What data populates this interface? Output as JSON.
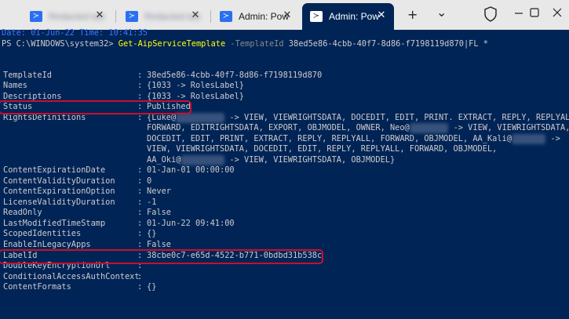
{
  "tabs": [
    {
      "title": "Redacted tab",
      "icon": "powershell-icon",
      "blurred": true,
      "active": false
    },
    {
      "title": "Redacted tab",
      "icon": "powershell-icon",
      "blurred": true,
      "active": false
    },
    {
      "title": "Admin: Pow",
      "icon": "powershell-icon",
      "blurred": false,
      "active": false
    },
    {
      "title": "Admin: Pow",
      "icon": "powershell-icon",
      "blurred": false,
      "active": true
    }
  ],
  "close_glyph": "✕",
  "new_tab_glyph": "+",
  "dropdown_glyph": "⌄",
  "icon_glyph": "≻",
  "terminal": {
    "date_line": "Date: 01-Jun-22 Time: 10:41:35",
    "prompt": "PS C:\\WINDOWS\\system32> ",
    "cmdlet": "Get-AipServiceTemplate",
    "param": "-TemplateId",
    "argument": "38ed5e86-4cbb-40f7-8d86-f7198119d870|FL *",
    "separator": ":",
    "props": {
      "templateid": {
        "key": "TemplateId",
        "value": "38ed5e86-4cbb-40f7-8d86-f7198119d870"
      },
      "names": {
        "key": "Names",
        "value": "{1033 -> RolesLabel}"
      },
      "descriptions": {
        "key": "Descriptions",
        "value": "{1033 -> RolesLabel}"
      },
      "status": {
        "key": "Status",
        "value": "Published"
      },
      "rights": {
        "key": "RightsDefinitions",
        "l1a": "{Luke@",
        "l1b": " -> VIEW, VIEWRIGHTSDATA, DOCEDIT, EDIT, PRINT. EXTRACT, REPLY, REPLYALL,",
        "l2a": "FORWARD, EDITRIGHTSDATA, EXPORT, OBJMODEL, OWNER, Neo@",
        "l2b": " -> VIEW, VIEWRIGHTSDATA,",
        "l3a": "DOCEDIT, EDIT, PRINT, EXTRACT, REPLY, REPLYALL, FORWARD, OBJMODEL, AA_Kali@",
        "l3b": " ->",
        "l4": "VIEW, VIEWRIGHTSDATA, DOCEDIT, EDIT, REPLY, REPLYALL, FORWARD, OBJMODEL,",
        "l5a": "AA_Oki@",
        "l5b": " -> VIEW, VIEWRIGHTSDATA, OBJMODEL}"
      },
      "contentexpirationdate": {
        "key": "ContentExpirationDate",
        "value": "01-Jan-01 00:00:00"
      },
      "contentvalidityduration": {
        "key": "ContentValidityDuration",
        "value": "0"
      },
      "contentexpirationoption": {
        "key": "ContentExpirationOption",
        "value": "Never"
      },
      "licensevalidityduration": {
        "key": "LicenseValidityDuration",
        "value": "-1"
      },
      "readonly": {
        "key": "ReadOnly",
        "value": "False"
      },
      "lastmodifiedtimestamp": {
        "key": "LastModifiedTimeStamp",
        "value": "01-Jun-22 09:41:00"
      },
      "scopedidentities": {
        "key": "ScopedIdentities",
        "value": "{}"
      },
      "enableinlegacyapps": {
        "key": "EnableInLegacyApps",
        "value": "False"
      },
      "labelid": {
        "key": "LabelId",
        "value": "38cbe0c7-e65d-4522-b771-0bdbd31b538c"
      },
      "doublekeyencryptionurl": {
        "key": "DoubleKeyEncryptionUrl",
        "value": ""
      },
      "conditionalaccessauthcontext": {
        "key": "ConditionalAccessAuthContext",
        "value": ""
      },
      "contentformats": {
        "key": "ContentFormats",
        "value": "{}"
      }
    }
  },
  "colors": {
    "terminal_bg": "#012456",
    "tabbar_bg": "#e8e8e8",
    "highlight": "#c8102e",
    "cmdlet": "#ffff00"
  }
}
